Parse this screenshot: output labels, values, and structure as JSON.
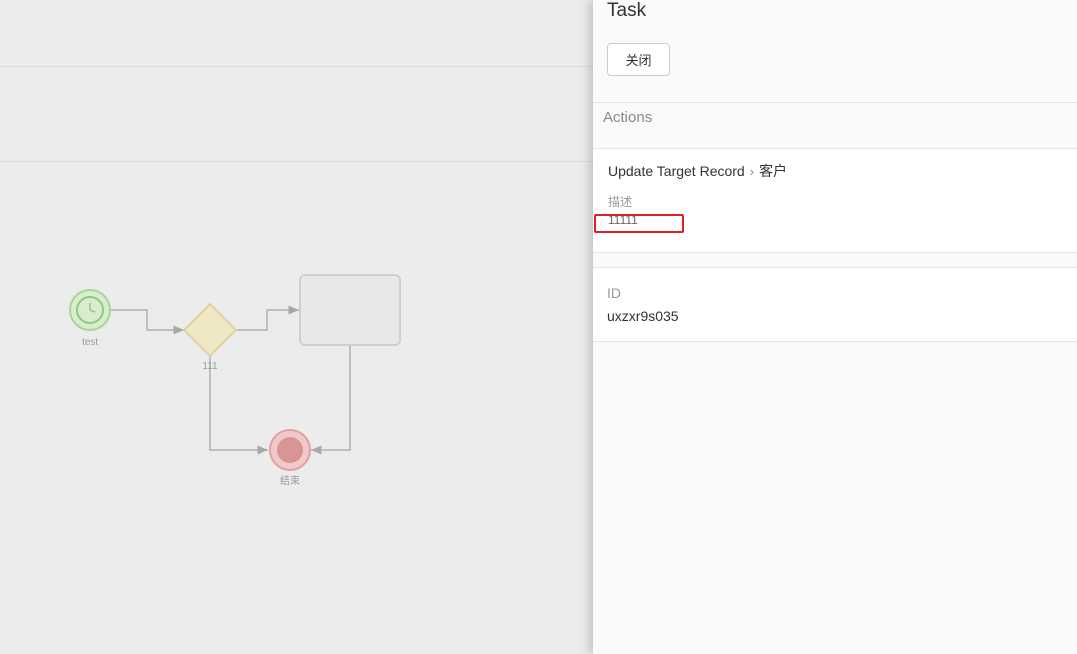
{
  "diagram": {
    "start_label": "test",
    "gateway_label": "111",
    "end_label": "结束"
  },
  "panel": {
    "title": "Task",
    "close_label": "关闭",
    "actions_heading": "Actions",
    "action": {
      "type": "Update Target Record",
      "separator": "›",
      "target": "客户",
      "description_label": "描述",
      "description_value": "11111"
    },
    "id_label": "ID",
    "id_value": "uxzxr9s035"
  },
  "colors": {
    "start_event": "#8fc97a",
    "gateway": "#e8dcaa",
    "end_event": "#d98b8b",
    "highlight": "#e02020"
  }
}
